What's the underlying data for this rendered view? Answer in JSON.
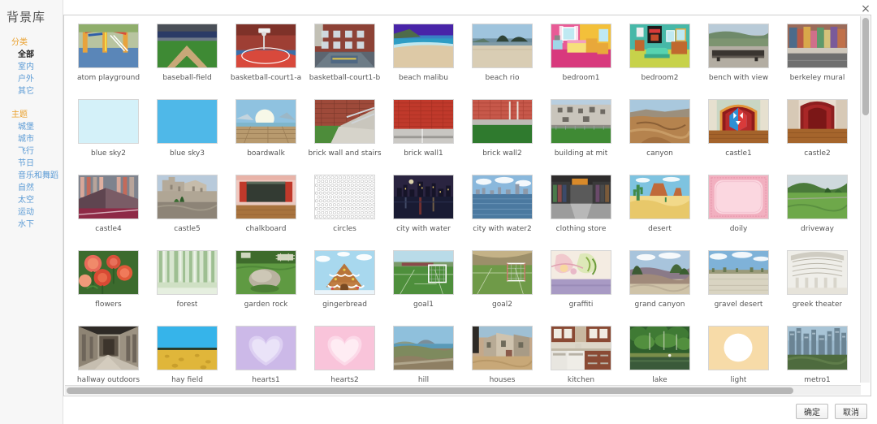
{
  "window": {
    "close_label": "×"
  },
  "sidebar": {
    "title": "背景库",
    "groups": [
      {
        "title": "分类",
        "items": [
          {
            "label": "全部",
            "active": true
          },
          {
            "label": "室内",
            "active": false
          },
          {
            "label": "户外",
            "active": false
          },
          {
            "label": "其它",
            "active": false
          }
        ]
      },
      {
        "title": "主题",
        "items": [
          {
            "label": "城堡",
            "active": false
          },
          {
            "label": "城市",
            "active": false
          },
          {
            "label": "飞行",
            "active": false
          },
          {
            "label": "节日",
            "active": false
          },
          {
            "label": "音乐和舞蹈",
            "active": false
          },
          {
            "label": "自然",
            "active": false
          },
          {
            "label": "太空",
            "active": false
          },
          {
            "label": "运动",
            "active": false
          },
          {
            "label": "水下",
            "active": false
          }
        ]
      }
    ]
  },
  "gallery": {
    "items": [
      {
        "label": "atom playground",
        "art": "atom-playground"
      },
      {
        "label": "baseball-field",
        "art": "baseball-field"
      },
      {
        "label": "basketball-court1-a",
        "art": "basketball-court-a"
      },
      {
        "label": "basketball-court1-b",
        "art": "basketball-court-b"
      },
      {
        "label": "beach malibu",
        "art": "beach-malibu"
      },
      {
        "label": "beach rio",
        "art": "beach-rio"
      },
      {
        "label": "bedroom1",
        "art": "bedroom1"
      },
      {
        "label": "bedroom2",
        "art": "bedroom2"
      },
      {
        "label": "bench with view",
        "art": "bench-with-view"
      },
      {
        "label": "berkeley mural",
        "art": "berkeley-mural"
      },
      {
        "label": "blue sky2",
        "art": "blue-sky2"
      },
      {
        "label": "blue sky3",
        "art": "blue-sky3"
      },
      {
        "label": "boardwalk",
        "art": "boardwalk"
      },
      {
        "label": "brick wall and stairs",
        "art": "brick-wall-stairs"
      },
      {
        "label": "brick wall1",
        "art": "brick-wall1"
      },
      {
        "label": "brick wall2",
        "art": "brick-wall2"
      },
      {
        "label": "building at mit",
        "art": "building-at-mit"
      },
      {
        "label": "canyon",
        "art": "canyon"
      },
      {
        "label": "castle1",
        "art": "castle1"
      },
      {
        "label": "castle2",
        "art": "castle2"
      },
      {
        "label": "castle4",
        "art": "castle4"
      },
      {
        "label": "castle5",
        "art": "castle5"
      },
      {
        "label": "chalkboard",
        "art": "chalkboard"
      },
      {
        "label": "circles",
        "art": "circles"
      },
      {
        "label": "city with water",
        "art": "city-with-water"
      },
      {
        "label": "city with water2",
        "art": "city-with-water2"
      },
      {
        "label": "clothing store",
        "art": "clothing-store"
      },
      {
        "label": "desert",
        "art": "desert"
      },
      {
        "label": "doily",
        "art": "doily"
      },
      {
        "label": "driveway",
        "art": "driveway"
      },
      {
        "label": "flowers",
        "art": "flowers"
      },
      {
        "label": "forest",
        "art": "forest"
      },
      {
        "label": "garden rock",
        "art": "garden-rock"
      },
      {
        "label": "gingerbread",
        "art": "gingerbread"
      },
      {
        "label": "goal1",
        "art": "goal1"
      },
      {
        "label": "goal2",
        "art": "goal2"
      },
      {
        "label": "graffiti",
        "art": "graffiti"
      },
      {
        "label": "grand canyon",
        "art": "grand-canyon"
      },
      {
        "label": "gravel desert",
        "art": "gravel-desert"
      },
      {
        "label": "greek theater",
        "art": "greek-theater"
      },
      {
        "label": "hallway outdoors",
        "art": "hallway-outdoors"
      },
      {
        "label": "hay field",
        "art": "hay-field"
      },
      {
        "label": "hearts1",
        "art": "hearts1"
      },
      {
        "label": "hearts2",
        "art": "hearts2"
      },
      {
        "label": "hill",
        "art": "hill"
      },
      {
        "label": "houses",
        "art": "houses"
      },
      {
        "label": "kitchen",
        "art": "kitchen"
      },
      {
        "label": "lake",
        "art": "lake"
      },
      {
        "label": "light",
        "art": "light"
      },
      {
        "label": "metro1",
        "art": "metro1"
      }
    ]
  },
  "footer": {
    "confirm_label": "确定",
    "cancel_label": "取消"
  },
  "colors": {
    "group_title": "#eaa02c",
    "nav_link": "#5b9bd5",
    "nav_active": "#222222",
    "panel_border": "#cfcfcf",
    "sidebar_bg": "#f7f7f7",
    "caption": "#555555"
  }
}
